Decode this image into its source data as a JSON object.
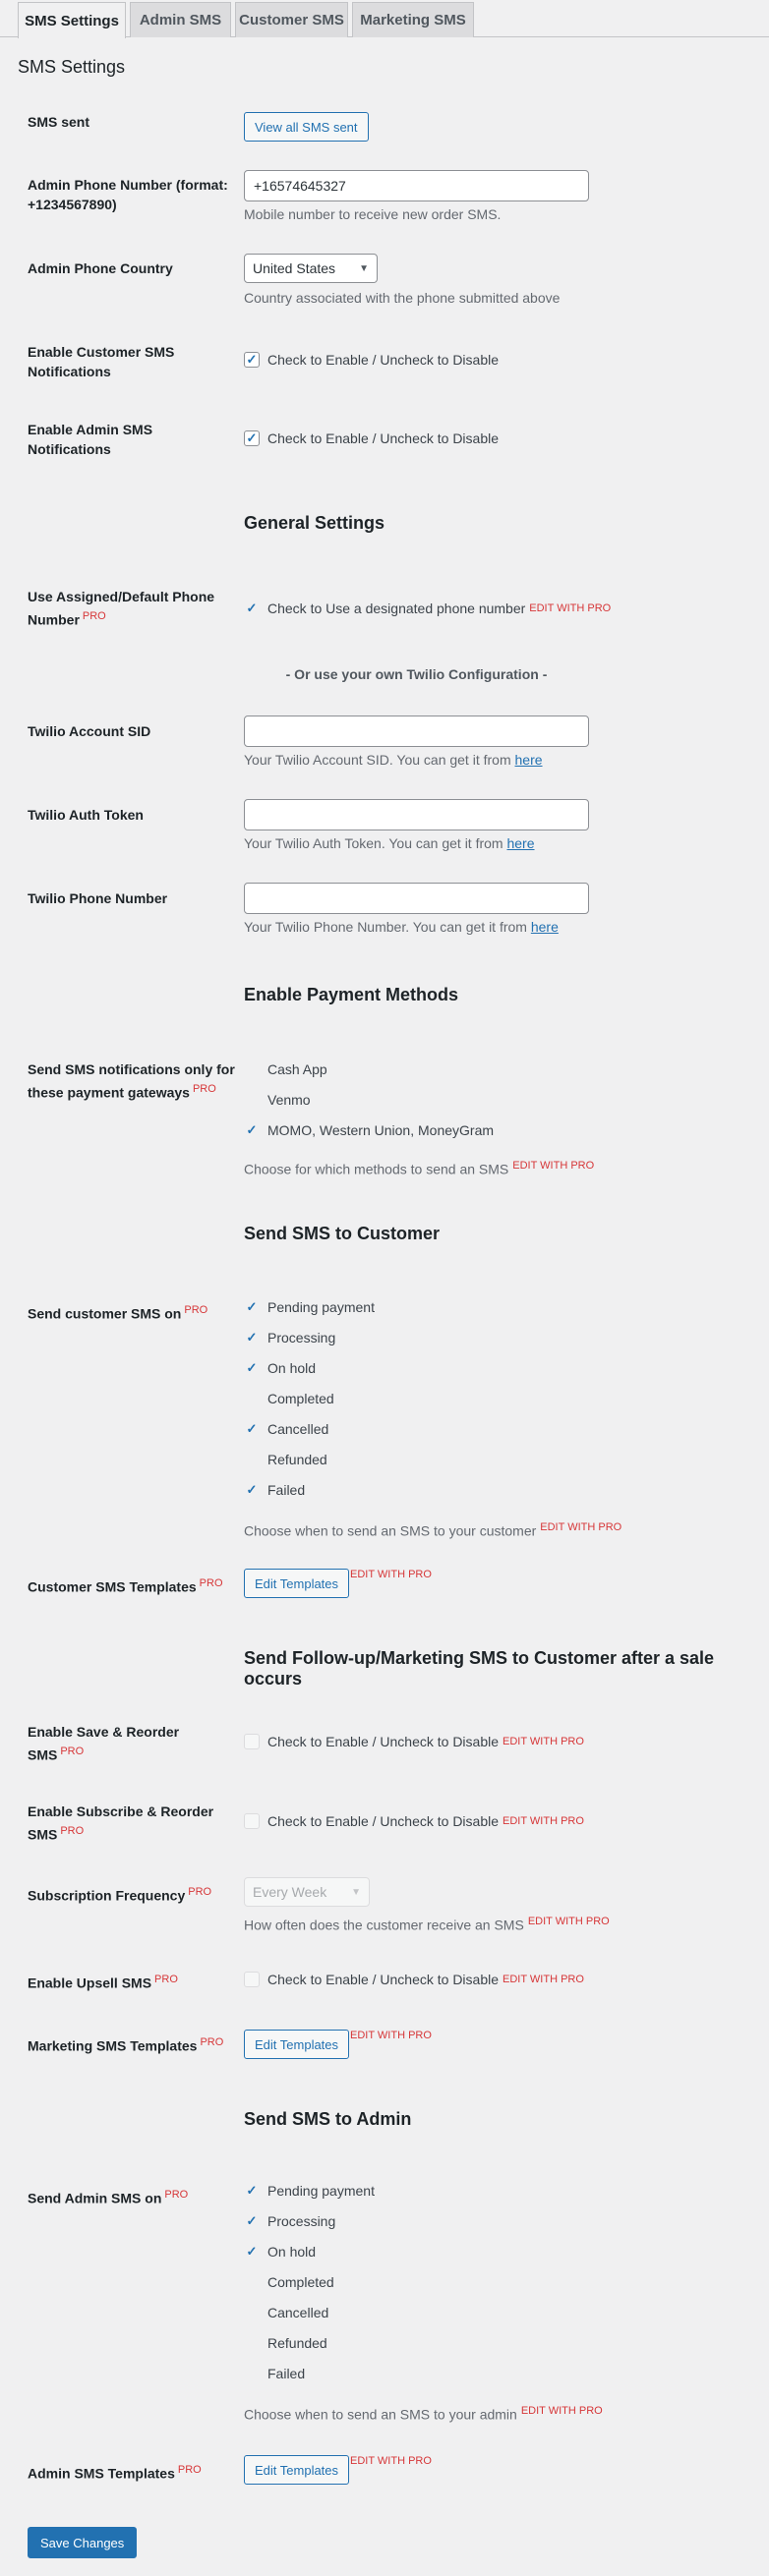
{
  "tabs": [
    "SMS Settings",
    "Admin SMS",
    "Customer SMS",
    "Marketing SMS"
  ],
  "page_title": "SMS Settings",
  "pro_label": "PRO",
  "edit_with_pro": "EDIT WITH PRO",
  "sms_sent": {
    "label": "SMS sent",
    "button": "View all SMS sent"
  },
  "admin_phone": {
    "label": "Admin Phone Number (format: +1234567890)",
    "value": "+16574645327",
    "description": "Mobile number to receive new order SMS."
  },
  "admin_country": {
    "label": "Admin Phone Country",
    "value": "United States",
    "description": "Country associated with the phone submitted above"
  },
  "enable_customer": {
    "label": "Enable Customer SMS Notifications",
    "text": "Check to Enable / Uncheck to Disable"
  },
  "enable_admin": {
    "label": "Enable Admin SMS Notifications",
    "text": "Check to Enable / Uncheck to Disable"
  },
  "general": {
    "heading": "General Settings",
    "assigned_label": "Use Assigned/Default Phone Number",
    "assigned_text": "Check to Use a designated phone number",
    "or_note": "- Or use your own Twilio Configuration -",
    "sid_label": "Twilio Account SID",
    "sid_desc": "Your Twilio Account SID. You can get it from",
    "token_label": "Twilio Auth Token",
    "token_desc": "Your Twilio Auth Token. You can get it from",
    "phone_label": "Twilio Phone Number",
    "phone_desc": "Your Twilio Phone Number. You can get it from",
    "here": "here"
  },
  "payment": {
    "heading": "Enable Payment Methods",
    "label": "Send SMS notifications only for these payment gateways",
    "options": [
      "Cash App",
      "Venmo",
      "MOMO, Western Union, MoneyGram"
    ],
    "checked": [
      false,
      false,
      true
    ],
    "description": "Choose for which methods to send an SMS"
  },
  "customer": {
    "heading": "Send SMS to Customer",
    "label": "Send customer SMS on",
    "options": [
      "Pending payment",
      "Processing",
      "On hold",
      "Completed",
      "Cancelled",
      "Refunded",
      "Failed"
    ],
    "checked": [
      true,
      true,
      true,
      false,
      true,
      false,
      true
    ],
    "description": "Choose when to send an SMS to your customer",
    "templates_label": "Customer SMS Templates",
    "templates_button": "Edit Templates"
  },
  "marketing": {
    "heading": "Send Follow-up/Marketing SMS to Customer after a sale occurs",
    "save_reorder_label": "Enable Save & Reorder SMS",
    "subscribe_reorder_label": "Enable Subscribe & Reorder SMS",
    "frequency_label": "Subscription Frequency",
    "frequency_value": "Every Week",
    "frequency_desc": "How often does the customer receive an SMS",
    "upsell_label": "Enable Upsell SMS",
    "check_text": "Check to Enable / Uncheck to Disable",
    "templates_label": "Marketing SMS Templates",
    "templates_button": "Edit Templates"
  },
  "admin": {
    "heading": "Send SMS to Admin",
    "label": "Send Admin SMS on",
    "options": [
      "Pending payment",
      "Processing",
      "On hold",
      "Completed",
      "Cancelled",
      "Refunded",
      "Failed"
    ],
    "checked": [
      true,
      true,
      true,
      false,
      false,
      false,
      false
    ],
    "description": "Choose when to send an SMS to your admin",
    "templates_label": "Admin SMS Templates",
    "templates_button": "Edit Templates"
  },
  "save_button": "Save Changes",
  "icons": {
    "check": "check-icon",
    "select_arrow": "chevron-down-icon"
  },
  "colors": {
    "accent": "#2271b1",
    "pro": "#d63638",
    "background": "#f0f0f1"
  }
}
